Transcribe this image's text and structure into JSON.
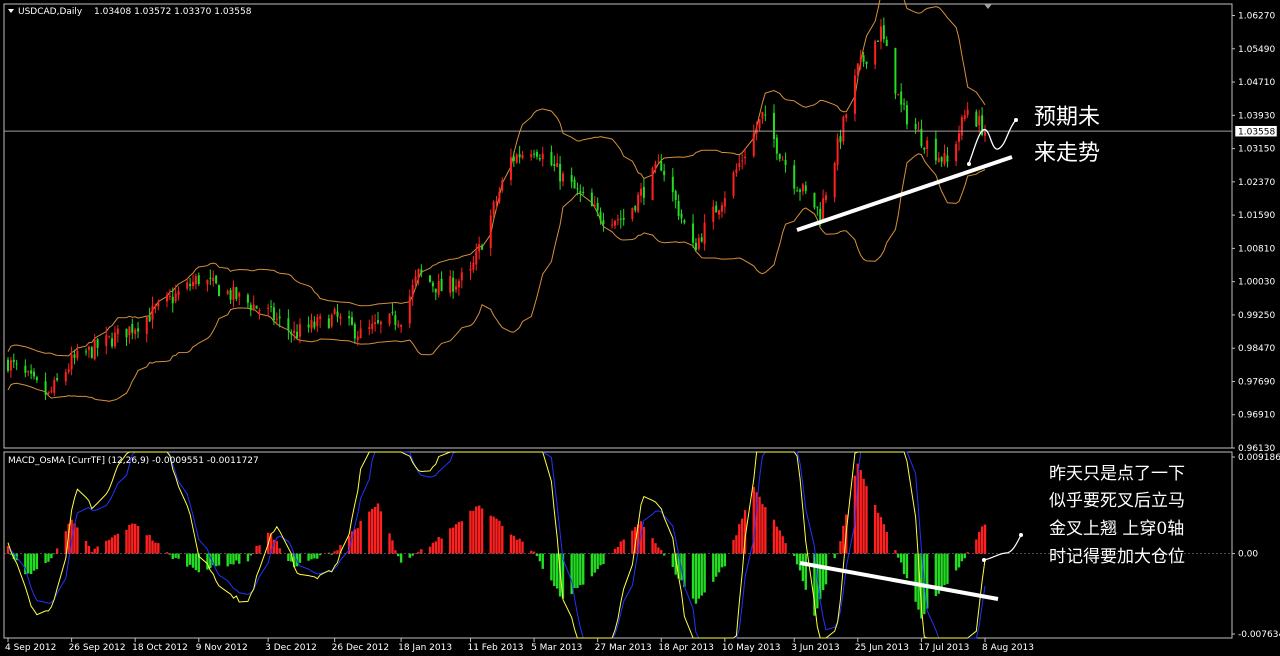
{
  "header": {
    "main_title": "USDCAD,Daily",
    "ohlc": "1.03408 1.03572 1.03370 1.03558",
    "macd_title": "MACD_OsMA [CurrTF] (12,26,9) -0.0009551 -0.0011727"
  },
  "colors": {
    "background": "#000000",
    "frame": "#c0c0c0",
    "bull": "#ff2020",
    "bear": "#22dd22",
    "band": "#d4903a",
    "macd_signal": "#ffff44",
    "macd_line": "#2233ff",
    "price_line": "#a0a0a0",
    "annotation": "#ffffff"
  },
  "icons": {
    "collapse": "triangle-down-icon",
    "shift_marker": "triangle-down-icon"
  },
  "current_price_label": "1.03558",
  "annotations": {
    "top_lines": [
      "预期未",
      "来走势"
    ],
    "bottom_lines": [
      "昨天只是点了一下",
      "似乎要死叉后立马",
      "金叉上翘 上穿0轴",
      "时记得要加大仓位"
    ]
  },
  "chart_data": [
    {
      "type": "candlestick",
      "title": "USDCAD,Daily",
      "indicators": [
        "Bollinger Bands"
      ],
      "price_axis_ticks": [
        "1.06270",
        "1.05490",
        "1.04710",
        "1.03930",
        "1.03150",
        "1.02370",
        "1.01590",
        "1.00810",
        "1.00030",
        "0.99250",
        "0.98470",
        "0.97690",
        "0.96910",
        "0.96130"
      ],
      "ylim": [
        0.9613,
        1.0654
      ],
      "current_price": 1.03558,
      "date_ticks": [
        "4 Sep 2012",
        "26 Sep 2012",
        "18 Oct 2012",
        "9 Nov 2012",
        "3 Dec 2012",
        "26 Dec 2012",
        "18 Jan 2013",
        "11 Feb 2013",
        "5 Mar 2013",
        "27 Mar 2013",
        "18 Apr 2013",
        "10 May 2013",
        "3 Jun 2013",
        "25 Jun 2013",
        "17 Jul 2013",
        "8 Aug 2013"
      ],
      "close_path": [
        {
          "date": "4 Sep 2012",
          "close": 0.9815
        },
        {
          "date": "18 Sep 2012",
          "close": 0.9735
        },
        {
          "date": "26 Sep 2012",
          "close": 0.9815
        },
        {
          "date": "18 Oct 2012",
          "close": 0.99
        },
        {
          "date": "9 Nov 2012",
          "close": 1.001
        },
        {
          "date": "3 Dec 2012",
          "close": 0.993
        },
        {
          "date": "12 Dec 2012",
          "close": 0.988
        },
        {
          "date": "26 Dec 2012",
          "close": 0.992
        },
        {
          "date": "4 Jan 2013",
          "close": 0.988
        },
        {
          "date": "18 Jan 2013",
          "close": 0.992
        },
        {
          "date": "24 Jan 2013",
          "close": 1.002
        },
        {
          "date": "1 Feb 2013",
          "close": 0.9985
        },
        {
          "date": "11 Feb 2013",
          "close": 1.002
        },
        {
          "date": "25 Feb 2013",
          "close": 1.029
        },
        {
          "date": "5 Mar 2013",
          "close": 1.032
        },
        {
          "date": "27 Mar 2013",
          "close": 1.016
        },
        {
          "date": "5 Apr 2013",
          "close": 1.015
        },
        {
          "date": "18 Apr 2013",
          "close": 1.028
        },
        {
          "date": "29 Apr 2013",
          "close": 1.008
        },
        {
          "date": "10 May 2013",
          "close": 1.021
        },
        {
          "date": "23 May 2013",
          "close": 1.039
        },
        {
          "date": "3 Jun 2013",
          "close": 1.024
        },
        {
          "date": "12 Jun 2013",
          "close": 1.0165
        },
        {
          "date": "25 Jun 2013",
          "close": 1.05
        },
        {
          "date": "3 Jul 2013",
          "close": 1.059
        },
        {
          "date": "10 Jul 2013",
          "close": 1.041
        },
        {
          "date": "17 Jul 2013",
          "close": 1.034
        },
        {
          "date": "26 Jul 2013",
          "close": 1.028
        },
        {
          "date": "2 Aug 2013",
          "close": 1.041
        },
        {
          "date": "8 Aug 2013",
          "close": 1.0356
        }
      ]
    },
    {
      "type": "bar",
      "title": "MACD_OsMA [CurrTF] (12,26,9) -0.0009551 -0.0011727",
      "series": [
        {
          "name": "OsMA"
        },
        {
          "name": "MACD"
        },
        {
          "name": "Signal"
        }
      ],
      "value_axis_ticks": [
        "0.009186",
        "0.00",
        "-0.007634"
      ],
      "ylim": [
        -0.007634,
        0.009186
      ],
      "last_values": [
        -0.0009551,
        -0.0011727
      ],
      "osma_path": [
        {
          "date": "4 Sep 2012",
          "osma": 0.0005
        },
        {
          "date": "10 Sep 2012",
          "osma": -0.002
        },
        {
          "date": "18 Sep 2012",
          "osma": -0.0008
        },
        {
          "date": "26 Sep 2012",
          "osma": 0.003
        },
        {
          "date": "3 Oct 2012",
          "osma": 0.0002
        },
        {
          "date": "18 Oct 2012",
          "osma": 0.0028
        },
        {
          "date": "30 Oct 2012",
          "osma": -0.0002
        },
        {
          "date": "9 Nov 2012",
          "osma": -0.0015
        },
        {
          "date": "26 Nov 2012",
          "osma": -0.0006
        },
        {
          "date": "3 Dec 2012",
          "osma": 0.002
        },
        {
          "date": "12 Dec 2012",
          "osma": -0.0012
        },
        {
          "date": "26 Dec 2012",
          "osma": 0.0002
        },
        {
          "date": "10 Jan 2013",
          "osma": 0.0045
        },
        {
          "date": "18 Jan 2013",
          "osma": -0.001
        },
        {
          "date": "1 Feb 2013",
          "osma": 0.0015
        },
        {
          "date": "14 Feb 2013",
          "osma": 0.0045
        },
        {
          "date": "5 Mar 2013",
          "osma": 0.0
        },
        {
          "date": "15 Mar 2013",
          "osma": -0.0042
        },
        {
          "date": "27 Mar 2013",
          "osma": -0.0015
        },
        {
          "date": "11 Apr 2013",
          "osma": 0.003
        },
        {
          "date": "18 Apr 2013",
          "osma": 0.0002
        },
        {
          "date": "30 Apr 2013",
          "osma": -0.0045
        },
        {
          "date": "10 May 2013",
          "osma": -0.001
        },
        {
          "date": "20 May 2013",
          "osma": 0.006
        },
        {
          "date": "3 Jun 2013",
          "osma": -0.0002
        },
        {
          "date": "10 Jun 2013",
          "osma": -0.0055
        },
        {
          "date": "18 Jun 2013",
          "osma": 0.0001
        },
        {
          "date": "25 Jun 2013",
          "osma": 0.008
        },
        {
          "date": "10 Jul 2013",
          "osma": -0.001
        },
        {
          "date": "17 Jul 2013",
          "osma": -0.0058
        },
        {
          "date": "1 Aug 2013",
          "osma": -0.0005
        },
        {
          "date": "8 Aug 2013",
          "osma": 0.0028
        },
        {
          "date": "14 Aug 2013",
          "osma": 0.0005
        }
      ]
    }
  ]
}
